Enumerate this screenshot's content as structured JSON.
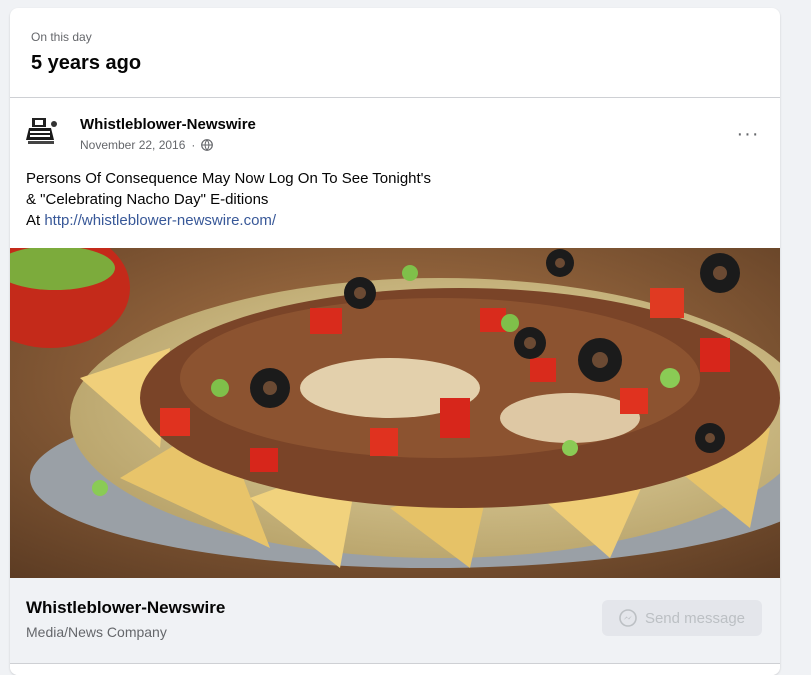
{
  "memory": {
    "eyebrow": "On this day",
    "title": "5 years ago"
  },
  "post": {
    "author": "Whistleblower-Newswire",
    "date": "November 22, 2016",
    "audience_icon": "globe-icon",
    "more_icon": "more-options-icon",
    "more_label": "···",
    "text_line1": "Persons Of Consequence May Now Log On To See Tonight's",
    "text_line2": "& \"Celebrating Nacho Day\" E-ditions",
    "text_prefix": "At ",
    "link": "http://whistleblower-newswire.com/",
    "image_icon": "nachos-photo"
  },
  "footer": {
    "page_name": "Whistleblower-Newswire",
    "category": "Media/News Company",
    "send_message_label": "Send message",
    "send_message_icon": "messenger-icon"
  },
  "colors": {
    "background": "#f0f2f5",
    "link": "#385898",
    "secondary_text": "#65676b"
  }
}
